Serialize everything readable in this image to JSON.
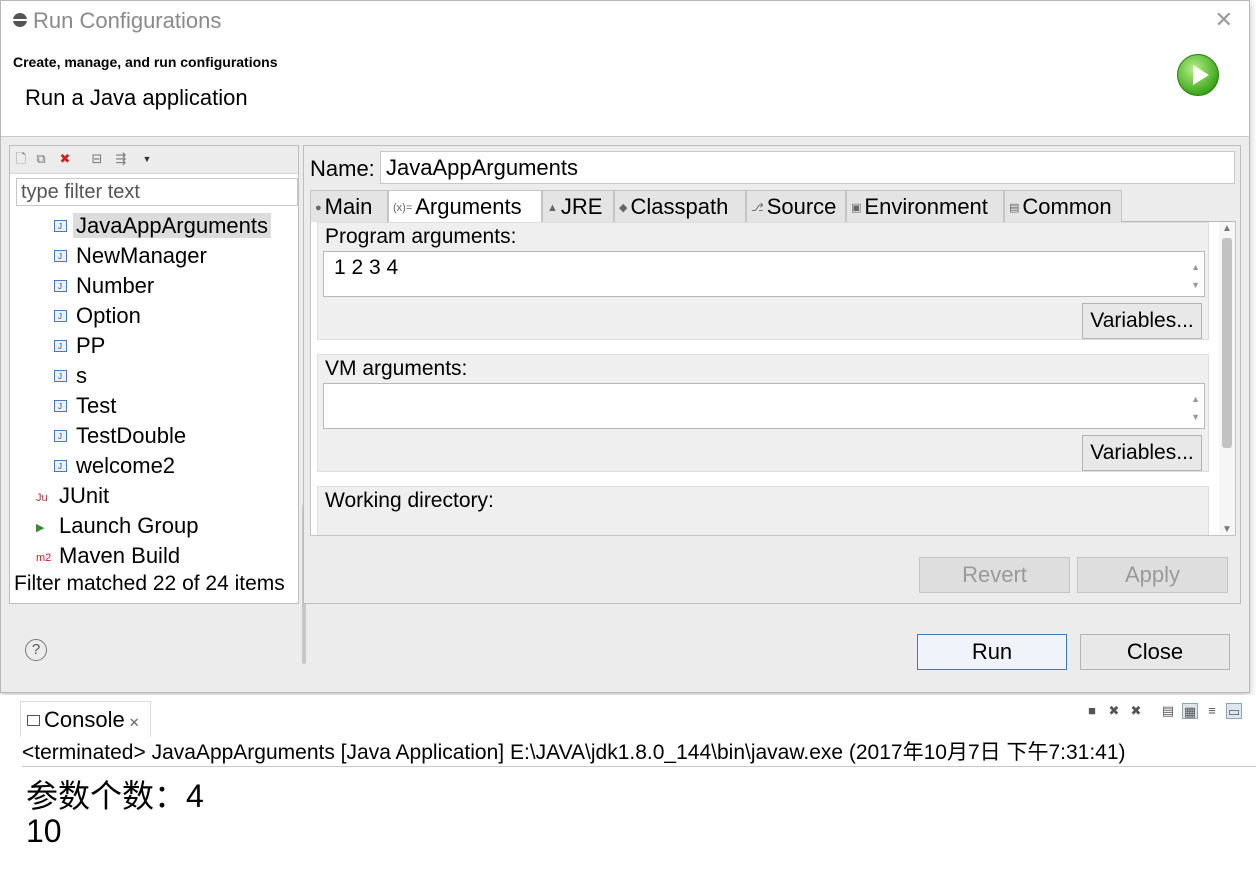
{
  "window": {
    "title": "Run Configurations",
    "header_title": "Create, manage, and run configurations",
    "header_desc": "Run a Java application"
  },
  "left": {
    "filter_placeholder": "type filter text",
    "items": [
      {
        "label": "JavaAppArguments",
        "type": "java",
        "selected": true
      },
      {
        "label": "NewManager",
        "type": "java"
      },
      {
        "label": "Number",
        "type": "java"
      },
      {
        "label": "Option",
        "type": "java"
      },
      {
        "label": "PP",
        "type": "java"
      },
      {
        "label": "s",
        "type": "java"
      },
      {
        "label": "Test",
        "type": "java"
      },
      {
        "label": "TestDouble",
        "type": "java"
      },
      {
        "label": "welcome2",
        "type": "java"
      },
      {
        "label": "JUnit",
        "type": "junit-category"
      },
      {
        "label": "Launch Group",
        "type": "launch-group-category"
      },
      {
        "label": "Maven Build",
        "type": "maven-category"
      }
    ],
    "status": "Filter matched 22 of 24 items"
  },
  "right": {
    "name_label": "Name:",
    "name_value": "JavaAppArguments",
    "tabs": [
      {
        "label": "Main",
        "icon": "main-icon",
        "glyph": "●"
      },
      {
        "label": "Arguments",
        "icon": "arguments-icon",
        "glyph": "(x)=",
        "active": true
      },
      {
        "label": "JRE",
        "icon": "jre-icon",
        "glyph": "▲"
      },
      {
        "label": "Classpath",
        "icon": "classpath-icon",
        "glyph": "◆"
      },
      {
        "label": "Source",
        "icon": "source-icon",
        "glyph": "⎇"
      },
      {
        "label": "Environment",
        "icon": "environment-icon",
        "glyph": "▣"
      },
      {
        "label": "Common",
        "icon": "common-icon",
        "glyph": "▤"
      }
    ],
    "program_args_label": "Program arguments:",
    "program_args_value": "1 2 3 4",
    "variables_label": "Variables...",
    "vm_args_label": "VM arguments:",
    "vm_args_value": "",
    "working_dir_label": "Working directory:",
    "revert_label": "Revert",
    "apply_label": "Apply"
  },
  "footer": {
    "help_glyph": "?",
    "run_label": "Run",
    "close_label": "Close"
  },
  "console": {
    "tab_label": "Console",
    "close_glyph": "✕",
    "status": "<terminated> JavaAppArguments [Java Application] E:\\JAVA\\jdk1.8.0_144\\bin\\javaw.exe (2017年10月7日 下午7:31:41)",
    "lines": [
      "参数个数：4",
      "10"
    ]
  }
}
